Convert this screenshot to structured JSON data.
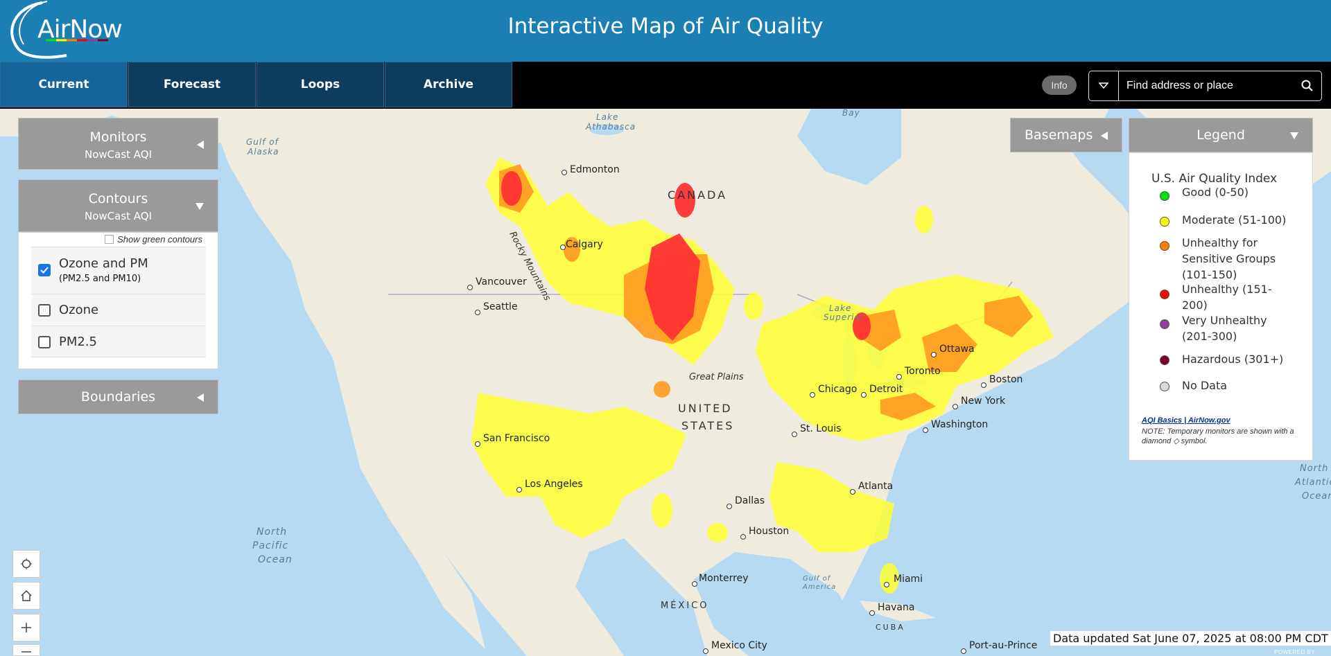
{
  "header": {
    "logo_text": "AirNow",
    "title": "Interactive Map of Air Quality"
  },
  "nav": {
    "tabs": [
      {
        "label": "Current",
        "active": true
      },
      {
        "label": "Forecast",
        "active": false
      },
      {
        "label": "Loops",
        "active": false
      },
      {
        "label": "Archive",
        "active": false
      }
    ],
    "info_label": "Info",
    "search_placeholder": "Find address or place"
  },
  "left_panels": {
    "monitors": {
      "title": "Monitors",
      "subtitle": "NowCast AQI"
    },
    "contours": {
      "title": "Contours",
      "subtitle": "NowCast AQI",
      "green_toggle_label": "Show green contours",
      "options": [
        {
          "label": "Ozone and PM",
          "sublabel": "(PM2.5 and PM10)",
          "checked": true
        },
        {
          "label": "Ozone",
          "checked": false
        },
        {
          "label": "PM2.5",
          "checked": false
        }
      ]
    },
    "boundaries": {
      "title": "Boundaries"
    }
  },
  "basemaps": {
    "title": "Basemaps"
  },
  "legend": {
    "title": "Legend",
    "index_title": "U.S. Air Quality Index",
    "items": [
      {
        "label": "Good (0-50)",
        "color": "#00e400"
      },
      {
        "label": "Moderate (51-100)",
        "color": "#ffff00"
      },
      {
        "label": "Unhealthy for Sensitive Groups (101-150)",
        "color": "#ff7e00"
      },
      {
        "label": "Unhealthy (151-200)",
        "color": "#ff0000"
      },
      {
        "label": "Very Unhealthy (201-300)",
        "color": "#8f3f97"
      },
      {
        "label": "Hazardous (301+)",
        "color": "#7e0023"
      },
      {
        "label": "No Data",
        "color": "#d9d9d9"
      }
    ],
    "link_text": "AQI Basics | AirNow.gov",
    "note": "NOTE: Temporary monitors are shown with a diamond ◇ symbol."
  },
  "map": {
    "region_labels": [
      "CANADA",
      "UNITED",
      "STATES",
      "MÉXICO",
      "CUBA",
      "Great Plains",
      "Rocky Mountains"
    ],
    "water_labels": [
      "Gulf of",
      "Alaska",
      "Lake",
      "Athabasca",
      "Bay",
      "Lake",
      "Superior",
      "North",
      "Pacific",
      "Ocean",
      "Gulf of",
      "America",
      "North",
      "Atlantic",
      "Ocean"
    ],
    "cities": [
      "Edmonton",
      "Calgary",
      "Vancouver",
      "Seattle",
      "San Francisco",
      "Los Angeles",
      "Dallas",
      "Houston",
      "Monterrey",
      "Mexico City",
      "Atlanta",
      "Miami",
      "Havana",
      "Chicago",
      "Detroit",
      "Toronto",
      "Ottawa",
      "Boston",
      "New York",
      "Washington",
      "St. Louis",
      "Port-au-Prince"
    ]
  },
  "status": {
    "updated": "Data updated Sat June 07, 2025 at 08:00 PM CDT",
    "powered": "POWERED BY"
  }
}
